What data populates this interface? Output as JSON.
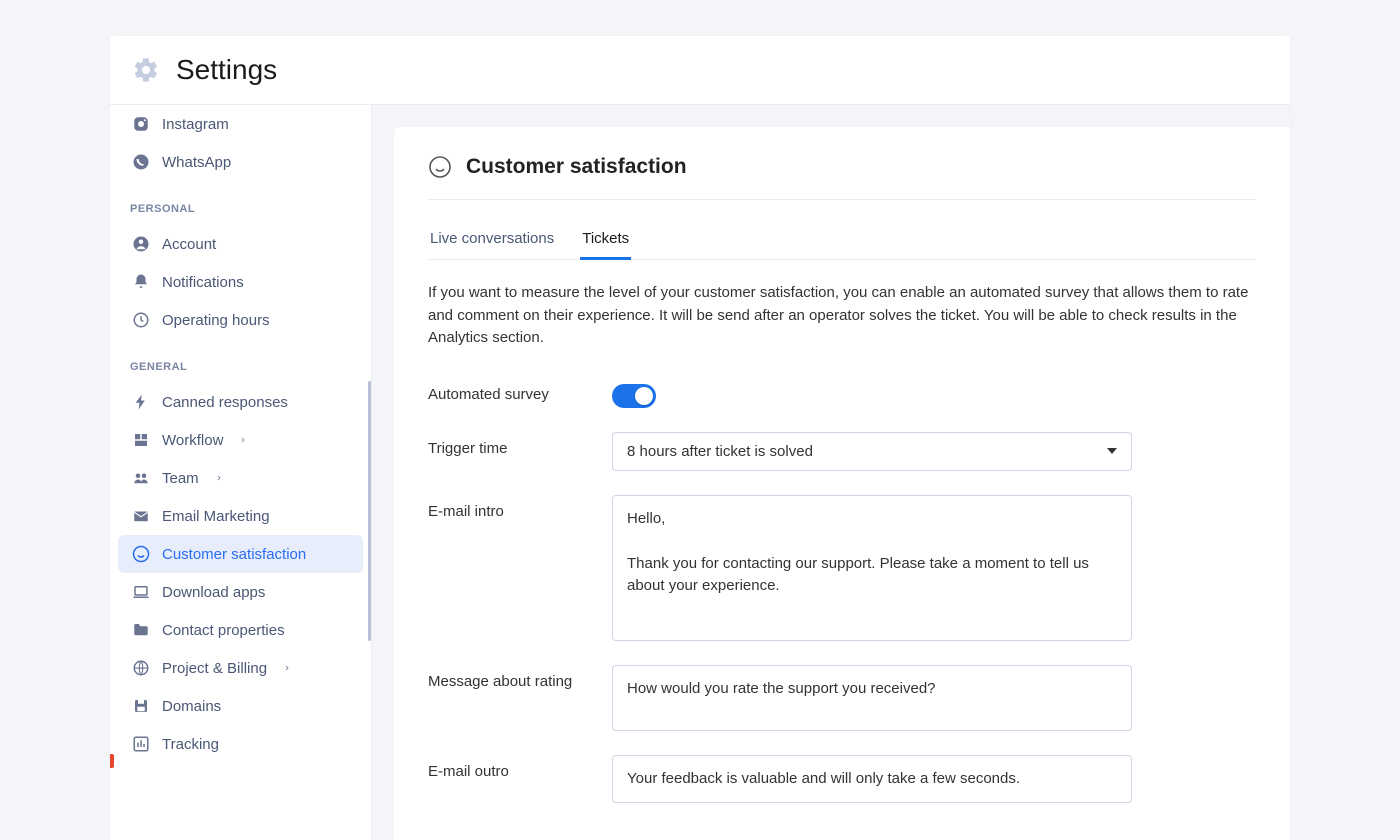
{
  "header": {
    "title": "Settings"
  },
  "sidebar": {
    "top_items": [
      {
        "id": "instagram",
        "label": "Instagram",
        "icon": "instagram-icon"
      },
      {
        "id": "whatsapp",
        "label": "WhatsApp",
        "icon": "whatsapp-icon"
      }
    ],
    "sections": [
      {
        "label": "PERSONAL",
        "items": [
          {
            "id": "account",
            "label": "Account",
            "icon": "account-icon"
          },
          {
            "id": "notifications",
            "label": "Notifications",
            "icon": "bell-icon"
          },
          {
            "id": "operating-hours",
            "label": "Operating hours",
            "icon": "clock-icon"
          }
        ]
      },
      {
        "label": "GENERAL",
        "items": [
          {
            "id": "canned",
            "label": "Canned responses",
            "icon": "bolt-icon"
          },
          {
            "id": "workflow",
            "label": "Workflow",
            "icon": "workflow-icon",
            "chevron": true
          },
          {
            "id": "team",
            "label": "Team",
            "icon": "team-icon",
            "chevron": true
          },
          {
            "id": "email",
            "label": "Email Marketing",
            "icon": "mail-icon"
          },
          {
            "id": "csat",
            "label": "Customer satisfaction",
            "icon": "smile-icon",
            "active": true
          },
          {
            "id": "download",
            "label": "Download apps",
            "icon": "laptop-icon"
          },
          {
            "id": "contact",
            "label": "Contact properties",
            "icon": "folder-icon"
          },
          {
            "id": "billing",
            "label": "Project & Billing",
            "icon": "globe-icon",
            "chevron": true
          },
          {
            "id": "domains",
            "label": "Domains",
            "icon": "save-icon"
          },
          {
            "id": "tracking",
            "label": "Tracking",
            "icon": "chart-icon"
          }
        ]
      }
    ]
  },
  "content": {
    "title": "Customer satisfaction",
    "tabs": [
      {
        "id": "live",
        "label": "Live conversations",
        "active": false
      },
      {
        "id": "tickets",
        "label": "Tickets",
        "active": true
      }
    ],
    "description": "If you want to measure the level of your customer satisfaction, you can enable an automated survey that allows them to rate and comment on their experience. It will be send after an operator solves the ticket. You will be able to check results in the Analytics section.",
    "fields": {
      "automated_survey_label": "Automated survey",
      "automated_survey_on": true,
      "trigger_time_label": "Trigger time",
      "trigger_time_value": "8 hours after ticket is solved",
      "email_intro_label": "E-mail intro",
      "email_intro_value": "Hello,\n\nThank you for contacting our support. Please take a moment to tell us about your experience.",
      "rating_label": "Message about rating",
      "rating_value": "How would you rate the support you received?",
      "email_outro_label": "E-mail outro",
      "email_outro_value": "Your feedback is valuable and will only take a few seconds."
    }
  }
}
